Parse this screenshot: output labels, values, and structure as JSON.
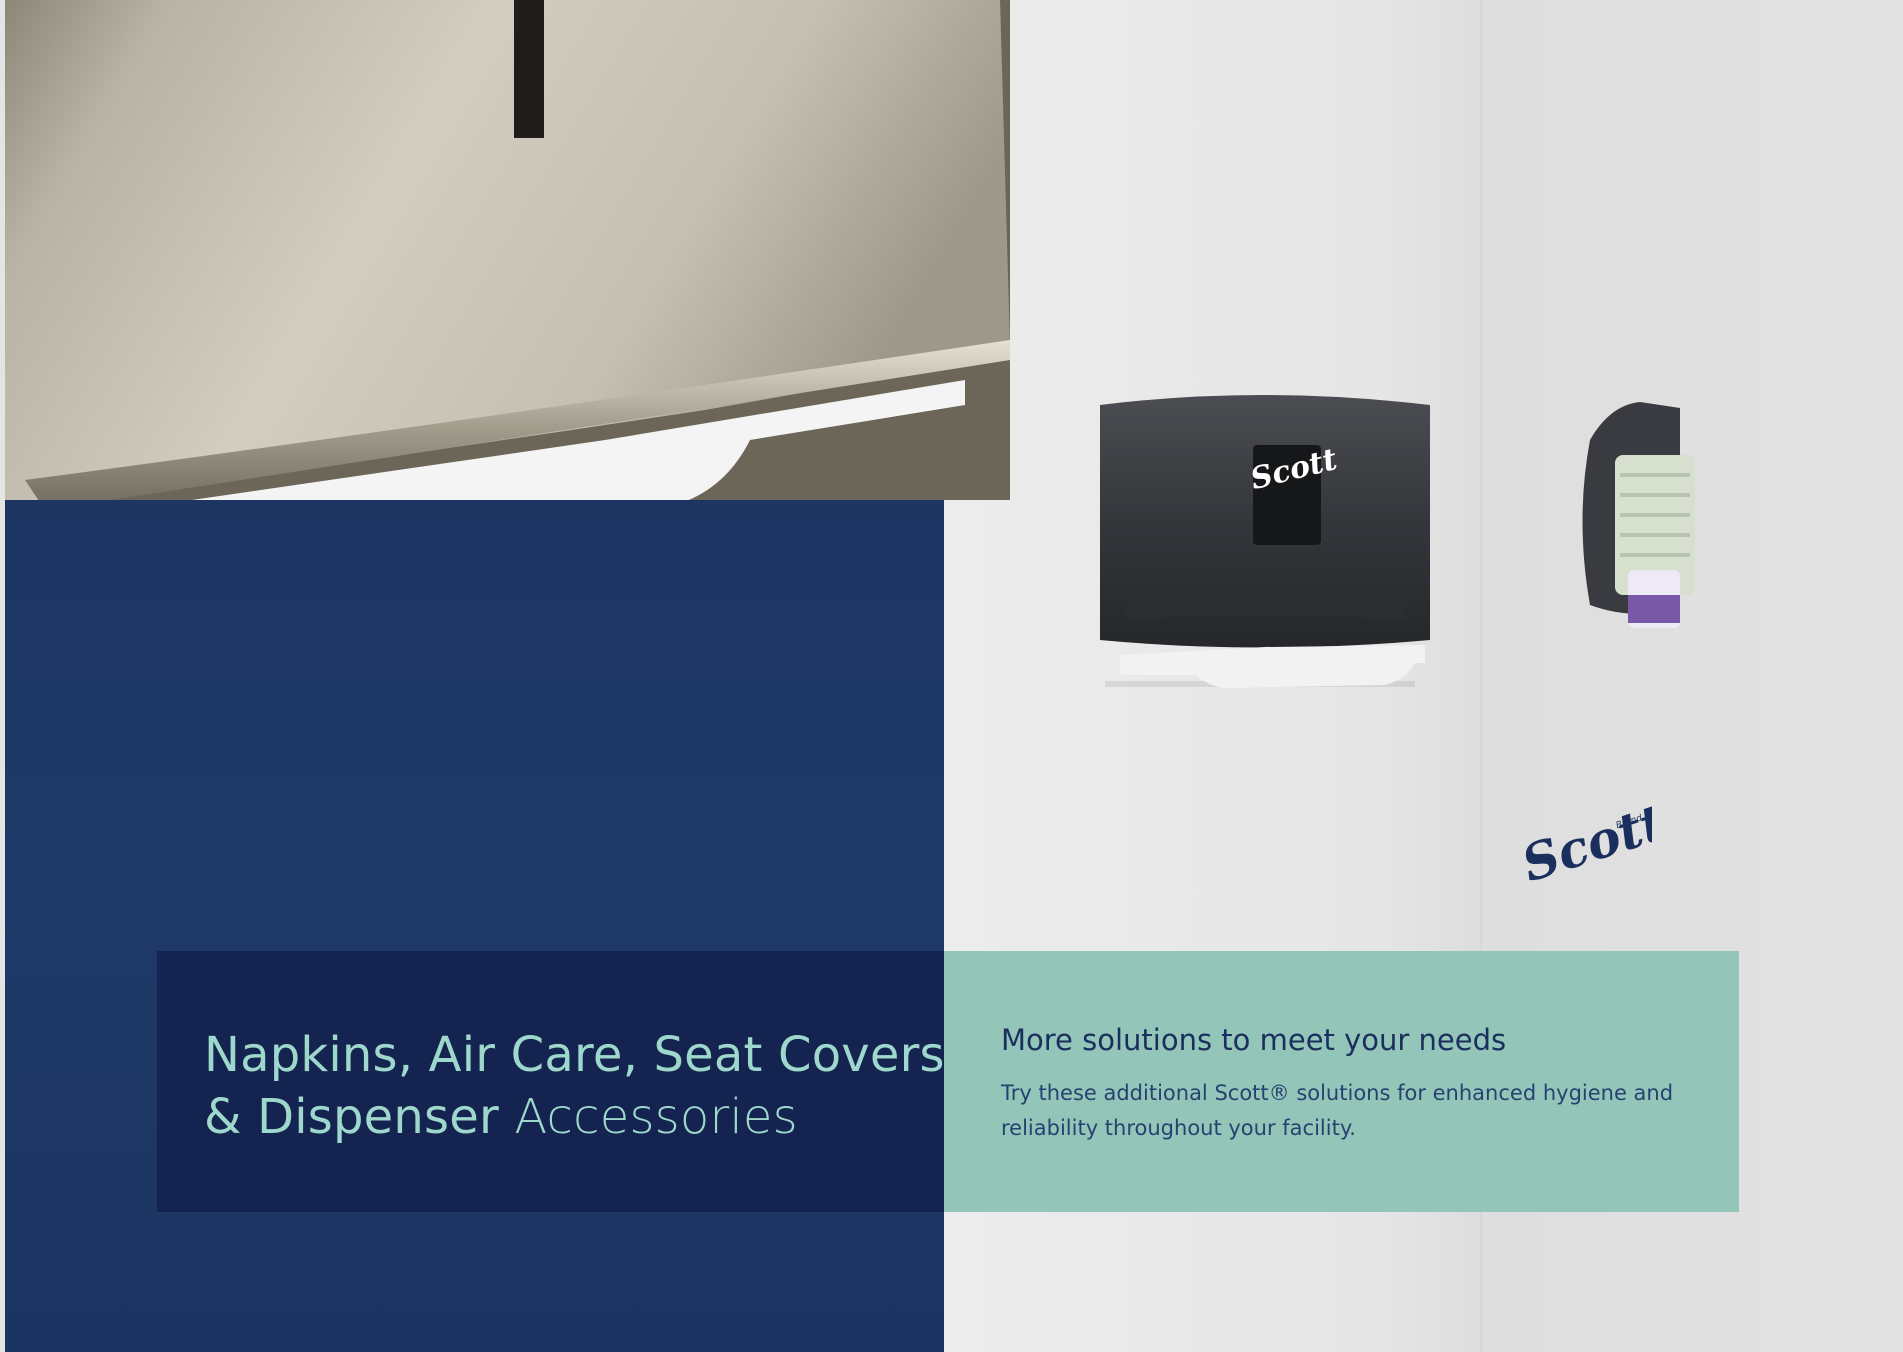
{
  "brand": {
    "logo_text": "Scott",
    "logo_subtext": "Brand",
    "dispenser_logo_text": "Scott"
  },
  "title_panel": {
    "line1": "Napkins, Air Care, Seat Covers",
    "line2_prefix": "& Dispenser",
    "line2_suffix": "Accessories"
  },
  "info_panel": {
    "heading": "More solutions to meet your needs",
    "body": "Try these additional Scott® solutions for enhanced hygiene and reliability throughout your facility."
  },
  "colors": {
    "navy": "#1d3461",
    "title_panel": "#152350",
    "teal": "#93c5b8",
    "title_text": "#9ed8cc",
    "heading_text": "#1b2f5e"
  }
}
